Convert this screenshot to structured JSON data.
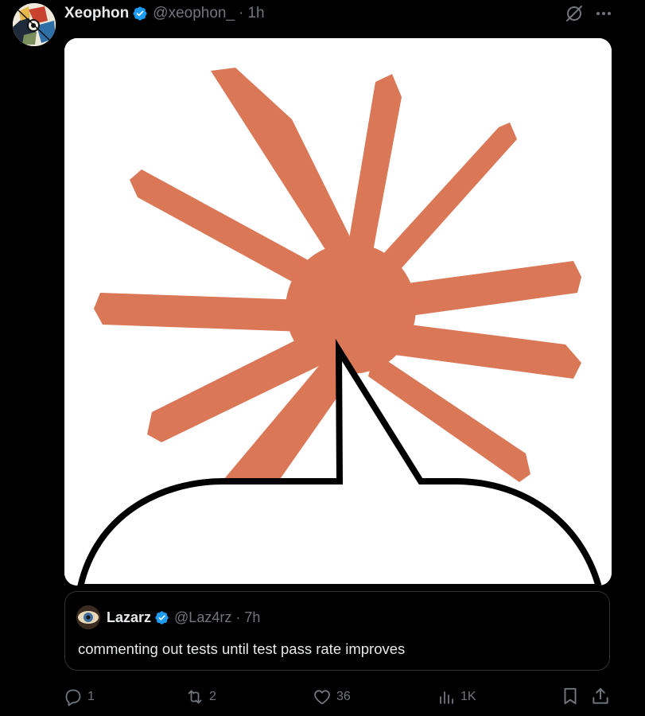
{
  "post": {
    "author_name": "Xeophon",
    "author_handle": "@xeophon_",
    "separator": "·",
    "time": "1h"
  },
  "quote": {
    "author_name": "Lazarz",
    "author_handle": "@Laz4rz",
    "separator": "·",
    "time": "7h",
    "text": "commenting out tests until test pass rate improves"
  },
  "actions": {
    "replies": "1",
    "reposts": "2",
    "likes": "36",
    "views": "1K"
  },
  "colors": {
    "accent_blue": "#1d9bf0",
    "secondary_text": "#71767b",
    "starburst": "#da7756"
  },
  "icons": [
    "verified-badge-icon",
    "grok-icon",
    "more-icon",
    "reply-icon",
    "repost-icon",
    "like-icon",
    "views-icon",
    "bookmark-icon",
    "share-icon"
  ]
}
